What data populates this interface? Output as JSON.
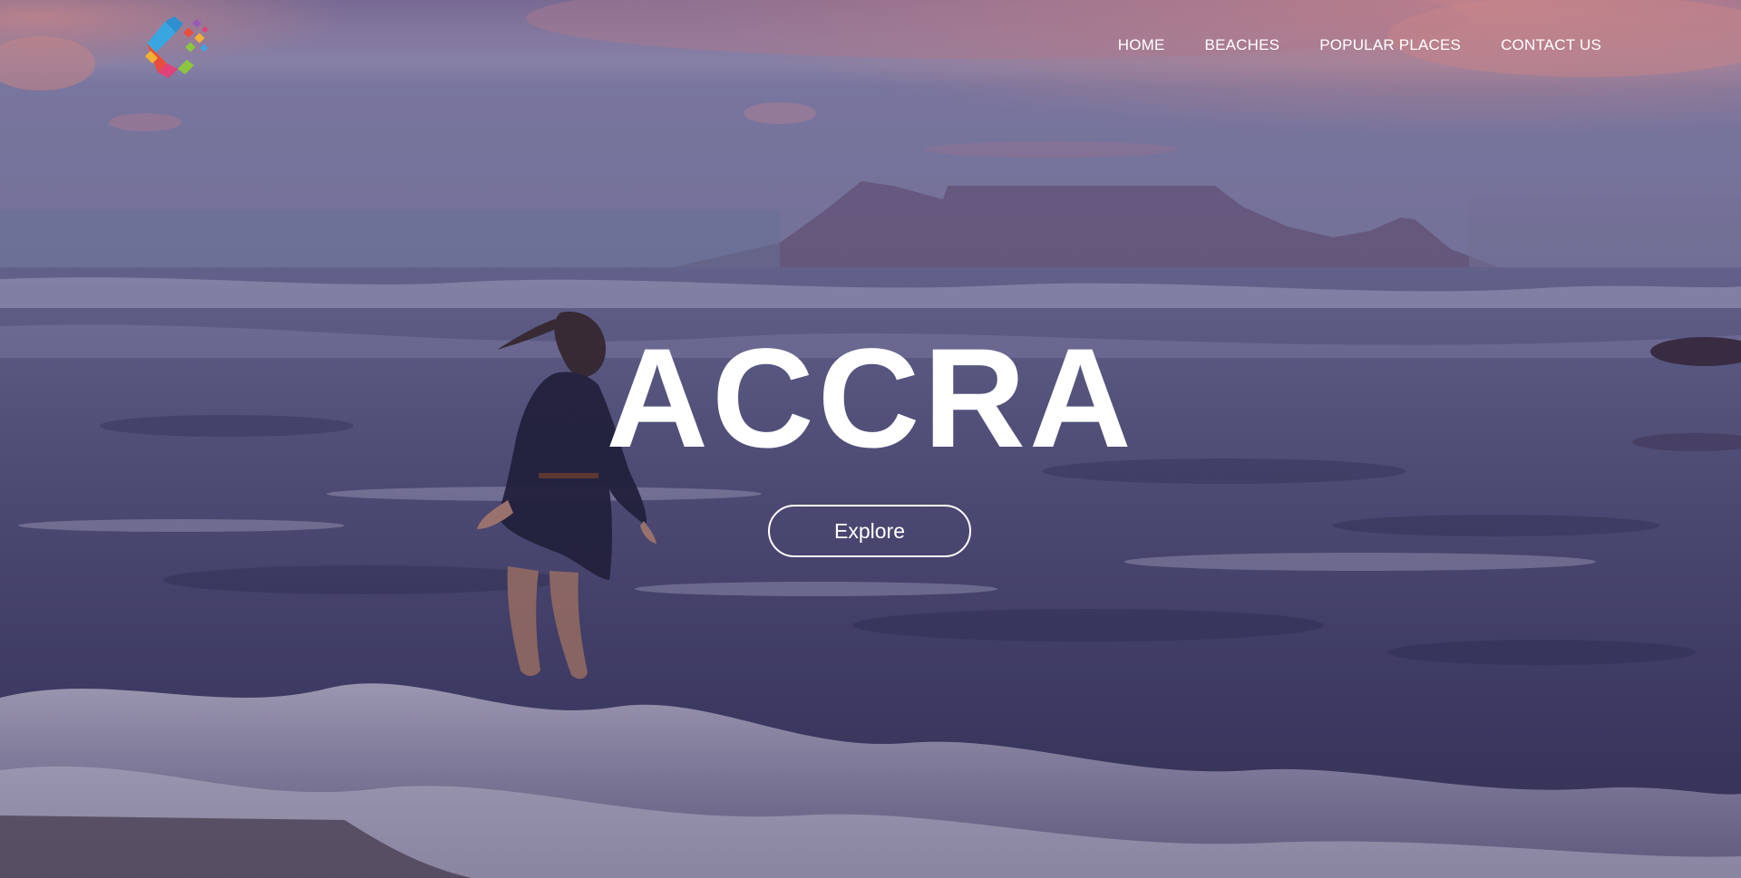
{
  "brand": {
    "logo_icon": "colorful-diamond-logo-icon",
    "colors": [
      "#3aa6e0",
      "#e94e3c",
      "#f2b134",
      "#8cc63f",
      "#9b59b6",
      "#e0427a"
    ]
  },
  "nav": {
    "items": [
      {
        "label": "HOME"
      },
      {
        "label": "BEACHES"
      },
      {
        "label": "POPULAR PLACES"
      },
      {
        "label": "CONTACT US"
      }
    ]
  },
  "hero": {
    "title": "ACCRA",
    "cta_label": "Explore",
    "background": "beach-at-dusk-woman-in-waves-with-table-mountain"
  },
  "colors": {
    "text": "#ffffff",
    "sky_top": "#7a6f96",
    "sky_glow": "#c98a9a",
    "sea": "#4c4a72",
    "foam": "#b8b4cf"
  }
}
